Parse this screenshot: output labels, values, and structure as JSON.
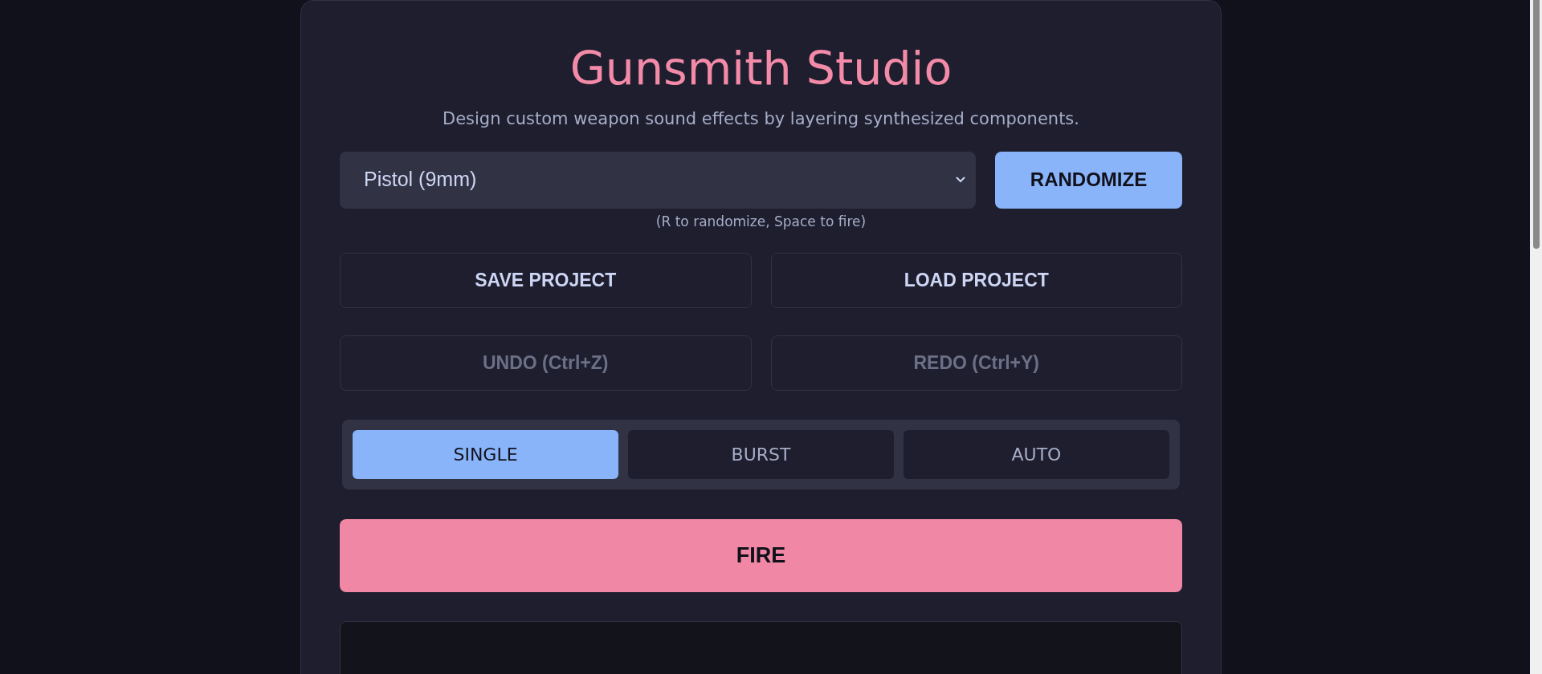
{
  "header": {
    "title": "Gunsmith Studio",
    "subtitle": "Design custom weapon sound effects by layering synthesized components."
  },
  "preset_select": {
    "value": "Pistol (9mm)"
  },
  "randomize_button": "RANDOMIZE",
  "shortcut_hint": "(R to randomize, Space to fire)",
  "project_buttons": [
    {
      "label": "SAVE PROJECT",
      "disabled": false
    },
    {
      "label": "LOAD PROJECT",
      "disabled": false
    },
    {
      "label": "UNDO (Ctrl+Z)",
      "disabled": true
    },
    {
      "label": "REDO (Ctrl+Y)",
      "disabled": true
    }
  ],
  "fire_modes": [
    {
      "label": "SINGLE",
      "selected": true
    },
    {
      "label": "BURST",
      "selected": false
    },
    {
      "label": "AUTO",
      "selected": false
    }
  ],
  "fire_button": "FIRE"
}
